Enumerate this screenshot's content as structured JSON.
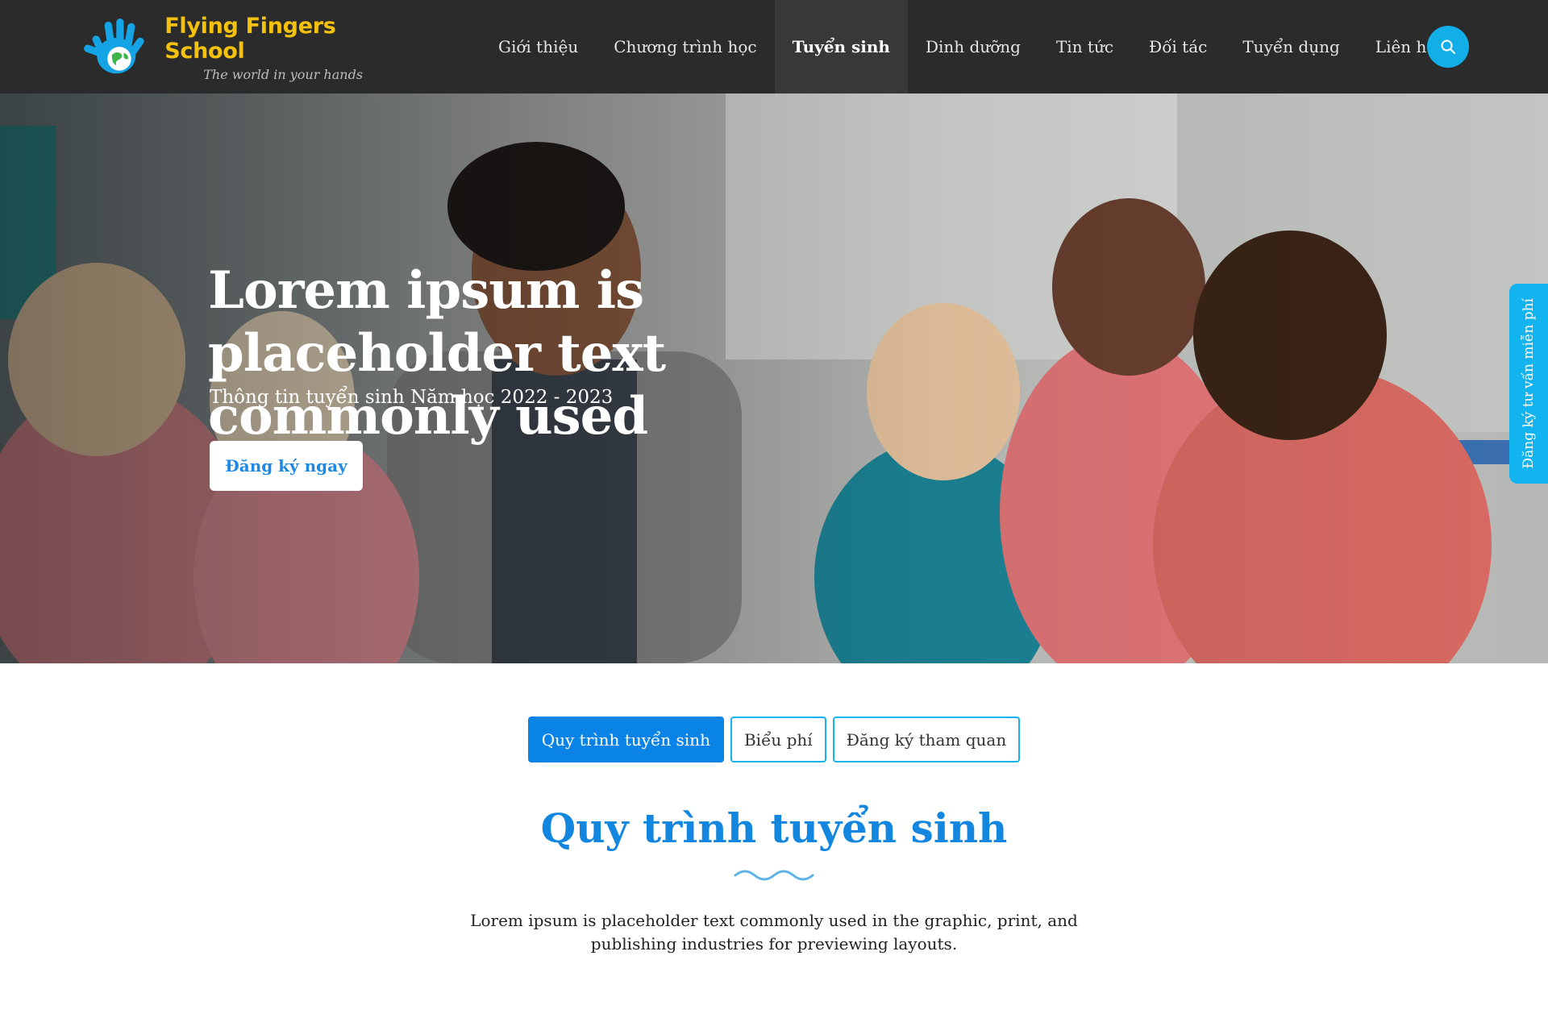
{
  "brand": {
    "name": "Flying Fingers School",
    "tagline": "The world in your hands"
  },
  "nav": {
    "items": [
      {
        "label": "Giới thiệu"
      },
      {
        "label": "Chương trình học"
      },
      {
        "label": "Tuyển sinh"
      },
      {
        "label": "Dinh dưỡng"
      },
      {
        "label": "Tin tức"
      },
      {
        "label": "Đối tác"
      },
      {
        "label": "Tuyển dụng"
      },
      {
        "label": "Liên hệ"
      }
    ],
    "active": "Tuyển sinh"
  },
  "hero": {
    "title": "Lorem ipsum is placeholder text commonly used",
    "subtitle": "Thông tin tuyển sinh Năm học 2022 - 2023",
    "cta_label": "Đăng ký ngay"
  },
  "side_tab": {
    "label": "Đăng ký tư vấn miễn phí"
  },
  "tabs": [
    {
      "label": "Quy trình tuyển sinh"
    },
    {
      "label": "Biểu phí"
    },
    {
      "label": "Đăng ký tham quan"
    }
  ],
  "section": {
    "title": "Quy trình tuyển sinh",
    "text": "Lorem ipsum is placeholder text commonly used in the graphic, print, and publishing industries for previewing layouts."
  },
  "colors": {
    "header_bg": "#2b2b2b",
    "accent_blue": "#0a83e6",
    "light_blue": "#11b4ef",
    "logo_yellow": "#f4c20d"
  },
  "icons": {
    "logo": "hand-globe-icon",
    "search": "search-icon",
    "divider": "wave-icon"
  }
}
